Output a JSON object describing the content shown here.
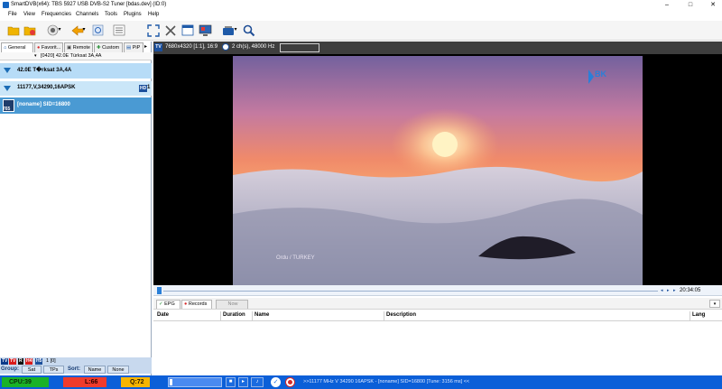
{
  "window": {
    "title": "SmartDVB(x64): TBS 5927 USB DVB-S2 Tuner [bdas.dev]  (ID:0)",
    "minimize": "–",
    "maximize": "□",
    "close": "✕"
  },
  "menu": {
    "items": [
      "File",
      "View",
      "Frequencies",
      "Channels",
      "Tools",
      "Plugins",
      "Help"
    ]
  },
  "left_pane": {
    "tabs": [
      "General",
      "Favorit...",
      "Remote",
      "Custom",
      "PiP"
    ],
    "selector": "[0420] 42.0E  Türksat 3A,4A",
    "tree": {
      "satellite": "42.0E   T�rksat 3A,4A",
      "transponder": "11177,V,34290,16APSK",
      "transponder_badge": "HD",
      "transponder_count": "1",
      "channel": "[noname] SID=16800",
      "channel_number": "765"
    },
    "status": {
      "filters": [
        "TV",
        "TV",
        "R",
        "H4",
        "H5"
      ],
      "counts": "1 [0]",
      "group_label": "Group:",
      "group_buttons": [
        "Sat",
        "TPs"
      ],
      "sort_label": "Sort:",
      "sort_buttons": [
        "Name",
        "None"
      ]
    }
  },
  "video": {
    "info_badge": "TV",
    "resolution": "7680x4320 [1:1], 16:9",
    "audio": "2 ch(s), 48000 Hz",
    "logo": "BK",
    "caption": "Ordu / TURKEY",
    "time": "20:34:05"
  },
  "epg": {
    "tabs": [
      "EPG",
      "Records",
      "Now"
    ],
    "columns": [
      "Date",
      "Duration",
      "Name",
      "Description",
      "Lang"
    ]
  },
  "statusbar": {
    "cpu": "CPU:39",
    "level": "L:66",
    "quality": "Q:72",
    "info": ">>11177 MHz V 34290 16APSK - [noname] SID=16800 [Tune: 3156 ms] <<"
  }
}
